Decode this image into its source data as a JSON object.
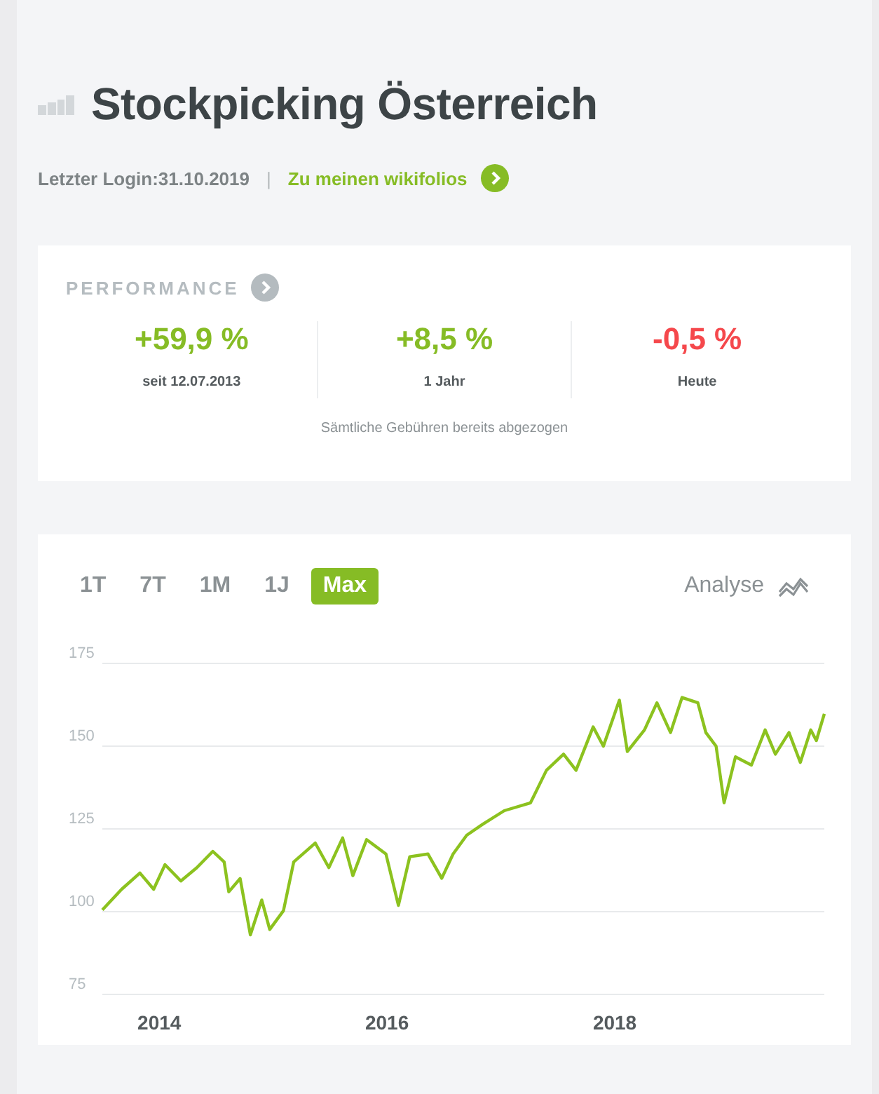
{
  "header": {
    "title": "Stockpicking Österreich",
    "last_login": "Letzter Login:31.10.2019",
    "separator": "|",
    "link": "Zu meinen wikifolios"
  },
  "performance": {
    "heading": "PERFORMANCE",
    "items": [
      {
        "value": "+59,9 %",
        "label": "seit 12.07.2013",
        "color": "#86bc25"
      },
      {
        "value": "+8,5 %",
        "label": "1 Jahr",
        "color": "#86bc25"
      },
      {
        "value": "-0,5 %",
        "label": "Heute",
        "color": "#f5484c"
      }
    ],
    "note": "Sämtliche Gebühren bereits abgezogen"
  },
  "chart": {
    "ranges": [
      {
        "label": "1T",
        "selected": false
      },
      {
        "label": "7T",
        "selected": false
      },
      {
        "label": "1M",
        "selected": false
      },
      {
        "label": "1J",
        "selected": false
      },
      {
        "label": "Max",
        "selected": true
      }
    ],
    "analyse": "Analyse",
    "chart_data": {
      "type": "line",
      "x": [
        2013.5,
        2013.67,
        2013.83,
        2013.95,
        2014.05,
        2014.19,
        2014.33,
        2014.47,
        2014.57,
        2014.61,
        2014.71,
        2014.8,
        2014.9,
        2014.97,
        2015.09,
        2015.18,
        2015.37,
        2015.49,
        2015.61,
        2015.7,
        2015.82,
        2015.99,
        2016.1,
        2016.2,
        2016.36,
        2016.48,
        2016.58,
        2016.7,
        2016.84,
        2017.03,
        2017.26,
        2017.4,
        2017.55,
        2017.66,
        2017.81,
        2017.9,
        2018.04,
        2018.11,
        2018.26,
        2018.37,
        2018.49,
        2018.59,
        2018.73,
        2018.8,
        2018.89,
        2018.96,
        2019.06,
        2019.2,
        2019.32,
        2019.41,
        2019.53,
        2019.63,
        2019.72,
        2019.77,
        2019.84
      ],
      "series": [
        {
          "color": "#8cc21f",
          "values": [
            100.5,
            106.8,
            111.7,
            106.8,
            114.2,
            109.3,
            113.3,
            118.2,
            115,
            106,
            110,
            93,
            103.5,
            94.6,
            100.3,
            115,
            120.7,
            113.3,
            122.3,
            110.9,
            121.8,
            117.4,
            101.9,
            116.6,
            117.4,
            110.1,
            117.4,
            123.1,
            126.4,
            130.5,
            132.9,
            142.7,
            147.6,
            142.7,
            155.8,
            150,
            163.9,
            148.4,
            154.9,
            163.1,
            154.1,
            164.7,
            163.1,
            154.1,
            150,
            132.9,
            146.8,
            144.3,
            154.9,
            147.6,
            154.1,
            145.1,
            154.9,
            151.7,
            159.8
          ]
        }
      ],
      "xlim": [
        2013.5,
        2019.84
      ],
      "ylim": [
        75,
        175
      ],
      "xticks": [
        {
          "value": 2014,
          "label": "2014"
        },
        {
          "value": 2016,
          "label": "2016"
        },
        {
          "value": 2018,
          "label": "2018"
        }
      ],
      "yticks": [
        75,
        100,
        125,
        150,
        175
      ],
      "grid": true
    }
  }
}
